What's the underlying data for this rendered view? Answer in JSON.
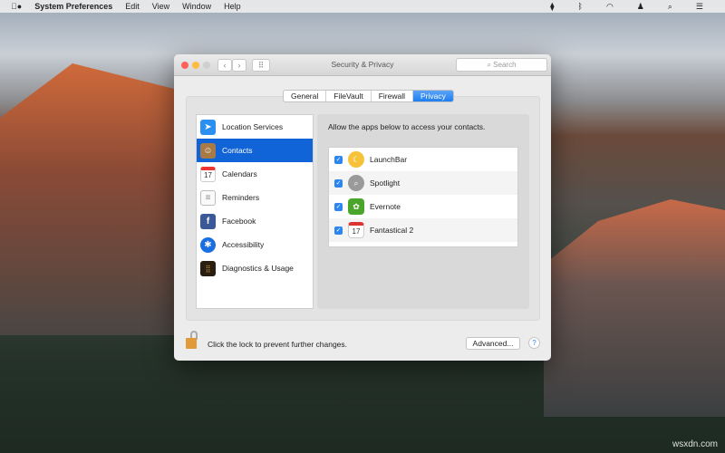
{
  "menubar": {
    "app": "System Preferences",
    "items": [
      "Edit",
      "View",
      "Window",
      "Help"
    ]
  },
  "window": {
    "title": "Security & Privacy",
    "search_placeholder": "Search",
    "tabs": [
      "General",
      "FileVault",
      "Firewall",
      "Privacy"
    ],
    "selected_tab": "Privacy",
    "sidebar": [
      {
        "label": "Location Services"
      },
      {
        "label": "Contacts"
      },
      {
        "label": "Calendars"
      },
      {
        "label": "Reminders"
      },
      {
        "label": "Facebook"
      },
      {
        "label": "Accessibility"
      },
      {
        "label": "Diagnostics & Usage"
      }
    ],
    "selected_item": "Contacts",
    "description": "Allow the apps below to access your contacts.",
    "apps": [
      {
        "name": "LaunchBar",
        "checked": true
      },
      {
        "name": "Spotlight",
        "checked": true
      },
      {
        "name": "Evernote",
        "checked": true
      },
      {
        "name": "Fantastical 2",
        "checked": true
      }
    ],
    "lock_text": "Click the lock to prevent further changes.",
    "advanced_label": "Advanced...",
    "help_label": "?",
    "calendar_day": "17"
  },
  "watermark": "wsxdn.com"
}
